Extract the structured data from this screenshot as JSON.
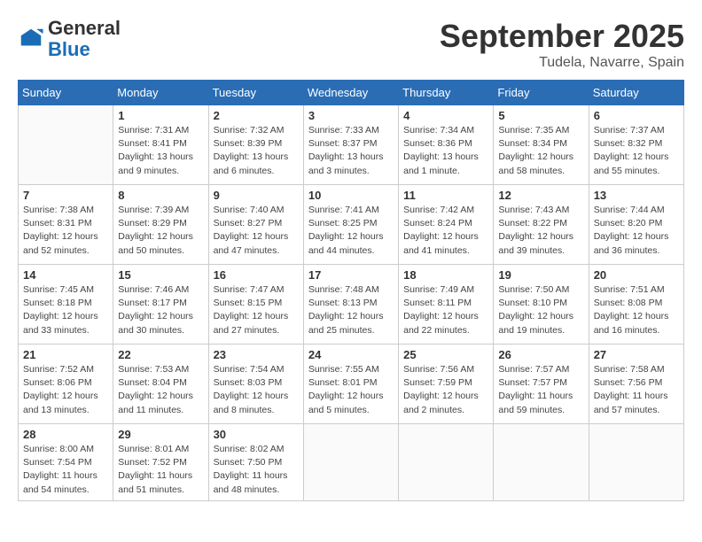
{
  "header": {
    "logo_general": "General",
    "logo_blue": "Blue",
    "month_title": "September 2025",
    "location": "Tudela, Navarre, Spain"
  },
  "days_of_week": [
    "Sunday",
    "Monday",
    "Tuesday",
    "Wednesday",
    "Thursday",
    "Friday",
    "Saturday"
  ],
  "weeks": [
    [
      {
        "day": "",
        "info": ""
      },
      {
        "day": "1",
        "info": "Sunrise: 7:31 AM\nSunset: 8:41 PM\nDaylight: 13 hours\nand 9 minutes."
      },
      {
        "day": "2",
        "info": "Sunrise: 7:32 AM\nSunset: 8:39 PM\nDaylight: 13 hours\nand 6 minutes."
      },
      {
        "day": "3",
        "info": "Sunrise: 7:33 AM\nSunset: 8:37 PM\nDaylight: 13 hours\nand 3 minutes."
      },
      {
        "day": "4",
        "info": "Sunrise: 7:34 AM\nSunset: 8:36 PM\nDaylight: 13 hours\nand 1 minute."
      },
      {
        "day": "5",
        "info": "Sunrise: 7:35 AM\nSunset: 8:34 PM\nDaylight: 12 hours\nand 58 minutes."
      },
      {
        "day": "6",
        "info": "Sunrise: 7:37 AM\nSunset: 8:32 PM\nDaylight: 12 hours\nand 55 minutes."
      }
    ],
    [
      {
        "day": "7",
        "info": "Sunrise: 7:38 AM\nSunset: 8:31 PM\nDaylight: 12 hours\nand 52 minutes."
      },
      {
        "day": "8",
        "info": "Sunrise: 7:39 AM\nSunset: 8:29 PM\nDaylight: 12 hours\nand 50 minutes."
      },
      {
        "day": "9",
        "info": "Sunrise: 7:40 AM\nSunset: 8:27 PM\nDaylight: 12 hours\nand 47 minutes."
      },
      {
        "day": "10",
        "info": "Sunrise: 7:41 AM\nSunset: 8:25 PM\nDaylight: 12 hours\nand 44 minutes."
      },
      {
        "day": "11",
        "info": "Sunrise: 7:42 AM\nSunset: 8:24 PM\nDaylight: 12 hours\nand 41 minutes."
      },
      {
        "day": "12",
        "info": "Sunrise: 7:43 AM\nSunset: 8:22 PM\nDaylight: 12 hours\nand 39 minutes."
      },
      {
        "day": "13",
        "info": "Sunrise: 7:44 AM\nSunset: 8:20 PM\nDaylight: 12 hours\nand 36 minutes."
      }
    ],
    [
      {
        "day": "14",
        "info": "Sunrise: 7:45 AM\nSunset: 8:18 PM\nDaylight: 12 hours\nand 33 minutes."
      },
      {
        "day": "15",
        "info": "Sunrise: 7:46 AM\nSunset: 8:17 PM\nDaylight: 12 hours\nand 30 minutes."
      },
      {
        "day": "16",
        "info": "Sunrise: 7:47 AM\nSunset: 8:15 PM\nDaylight: 12 hours\nand 27 minutes."
      },
      {
        "day": "17",
        "info": "Sunrise: 7:48 AM\nSunset: 8:13 PM\nDaylight: 12 hours\nand 25 minutes."
      },
      {
        "day": "18",
        "info": "Sunrise: 7:49 AM\nSunset: 8:11 PM\nDaylight: 12 hours\nand 22 minutes."
      },
      {
        "day": "19",
        "info": "Sunrise: 7:50 AM\nSunset: 8:10 PM\nDaylight: 12 hours\nand 19 minutes."
      },
      {
        "day": "20",
        "info": "Sunrise: 7:51 AM\nSunset: 8:08 PM\nDaylight: 12 hours\nand 16 minutes."
      }
    ],
    [
      {
        "day": "21",
        "info": "Sunrise: 7:52 AM\nSunset: 8:06 PM\nDaylight: 12 hours\nand 13 minutes."
      },
      {
        "day": "22",
        "info": "Sunrise: 7:53 AM\nSunset: 8:04 PM\nDaylight: 12 hours\nand 11 minutes."
      },
      {
        "day": "23",
        "info": "Sunrise: 7:54 AM\nSunset: 8:03 PM\nDaylight: 12 hours\nand 8 minutes."
      },
      {
        "day": "24",
        "info": "Sunrise: 7:55 AM\nSunset: 8:01 PM\nDaylight: 12 hours\nand 5 minutes."
      },
      {
        "day": "25",
        "info": "Sunrise: 7:56 AM\nSunset: 7:59 PM\nDaylight: 12 hours\nand 2 minutes."
      },
      {
        "day": "26",
        "info": "Sunrise: 7:57 AM\nSunset: 7:57 PM\nDaylight: 11 hours\nand 59 minutes."
      },
      {
        "day": "27",
        "info": "Sunrise: 7:58 AM\nSunset: 7:56 PM\nDaylight: 11 hours\nand 57 minutes."
      }
    ],
    [
      {
        "day": "28",
        "info": "Sunrise: 8:00 AM\nSunset: 7:54 PM\nDaylight: 11 hours\nand 54 minutes."
      },
      {
        "day": "29",
        "info": "Sunrise: 8:01 AM\nSunset: 7:52 PM\nDaylight: 11 hours\nand 51 minutes."
      },
      {
        "day": "30",
        "info": "Sunrise: 8:02 AM\nSunset: 7:50 PM\nDaylight: 11 hours\nand 48 minutes."
      },
      {
        "day": "",
        "info": ""
      },
      {
        "day": "",
        "info": ""
      },
      {
        "day": "",
        "info": ""
      },
      {
        "day": "",
        "info": ""
      }
    ]
  ]
}
